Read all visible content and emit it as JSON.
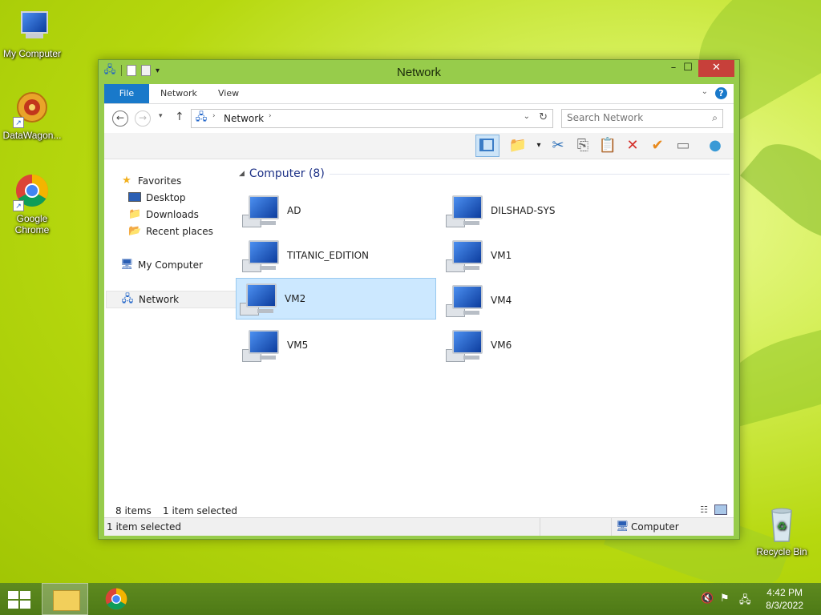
{
  "desktop": {
    "icons": [
      {
        "label": "My Computer"
      },
      {
        "label": "DataWagon..."
      },
      {
        "label": "Google Chrome"
      },
      {
        "label": "Recycle Bin"
      }
    ]
  },
  "window": {
    "title": "Network",
    "ribbon": {
      "tabs": [
        "File",
        "Network",
        "View"
      ]
    },
    "address": {
      "path": "Network"
    },
    "search": {
      "placeholder": "Search Network"
    },
    "nav": {
      "favorites": "Favorites",
      "desktop": "Desktop",
      "downloads": "Downloads",
      "recent": "Recent places",
      "my_computer": "My Computer",
      "network": "Network"
    },
    "group": {
      "header": "Computer (8)"
    },
    "computers": [
      {
        "name": "AD",
        "selected": false
      },
      {
        "name": "DILSHAD-SYS",
        "selected": false
      },
      {
        "name": "TITANIC_EDITION",
        "selected": false
      },
      {
        "name": "VM1",
        "selected": false
      },
      {
        "name": "VM2",
        "selected": true
      },
      {
        "name": "VM4",
        "selected": false
      },
      {
        "name": "VM5",
        "selected": false
      },
      {
        "name": "VM6",
        "selected": false
      }
    ],
    "status": {
      "items_count": "8 items",
      "selected_count": "1 item selected",
      "bottom_left": "1 item selected",
      "bottom_right": "Computer"
    }
  },
  "taskbar": {
    "time": "4:42 PM",
    "date": "8/3/2022"
  }
}
